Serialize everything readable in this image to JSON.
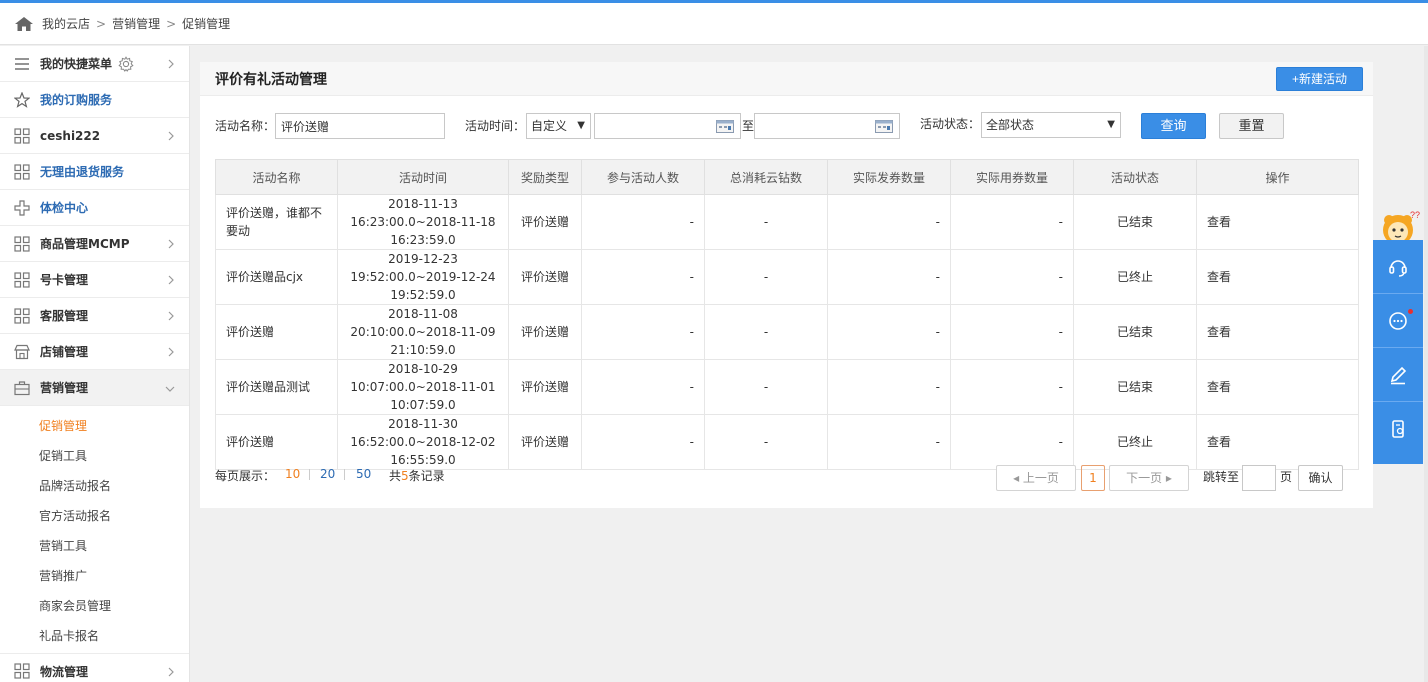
{
  "breadcrumb": [
    "我的云店",
    "营销管理",
    "促销管理"
  ],
  "sidebar": {
    "items": [
      {
        "label": "我的快捷菜单",
        "icon": "menu-lines-icon",
        "blue": false
      },
      {
        "label": "我的订购服务",
        "icon": "star-icon",
        "blue": true
      },
      {
        "label": "ceshi222",
        "icon": "grid-icon",
        "blue": false
      },
      {
        "label": "无理由退货服务",
        "icon": "grid-icon",
        "blue": true
      },
      {
        "label": "体检中心",
        "icon": "plus-icon",
        "blue": true
      },
      {
        "label": "商品管理MCMP",
        "icon": "grid-icon",
        "blue": false
      },
      {
        "label": "号卡管理",
        "icon": "grid-icon",
        "blue": false
      },
      {
        "label": "客服管理",
        "icon": "grid-icon",
        "blue": false
      },
      {
        "label": "店铺管理",
        "icon": "store-icon",
        "blue": false
      },
      {
        "label": "营销管理",
        "icon": "briefcase-icon",
        "blue": false
      }
    ],
    "submenu": [
      "促销管理",
      "促销工具",
      "品牌活动报名",
      "官方活动报名",
      "营销工具",
      "营销推广",
      "商家会员管理",
      "礼品卡报名"
    ],
    "bottom_item": {
      "label": "物流管理",
      "icon": "grid-icon"
    }
  },
  "panel": {
    "title": "评价有礼活动管理",
    "new_button": "+新建活动"
  },
  "filters": {
    "name_label": "活动名称：",
    "name_value": "评价送赠",
    "time_label": "活动时间：",
    "time_mode": "自定义",
    "to_label": "至",
    "start_date": "",
    "end_date": "",
    "status_label": "活动状态：",
    "status_value": "全部状态",
    "query_button": "查询",
    "reset_button": "重置"
  },
  "table": {
    "columns": [
      "活动名称",
      "活动时间",
      "奖励类型",
      "参与活动人数",
      "总消耗云钻数",
      "实际发券数量",
      "实际用券数量",
      "活动状态",
      "操作"
    ],
    "rows": [
      {
        "name": "评价送赠，谁都不要动",
        "time": "2018-11-13 16:23:00.0~2018-11-18 16:23:59.0",
        "reward": "评价送赠",
        "participants": "-",
        "consumed": "-",
        "issued": "-",
        "used": "-",
        "status": "已结束",
        "action": "查看"
      },
      {
        "name": "评价送赠品cjx",
        "time": "2019-12-23 19:52:00.0~2019-12-24 19:52:59.0",
        "reward": "评价送赠",
        "participants": "-",
        "consumed": "-",
        "issued": "-",
        "used": "-",
        "status": "已终止",
        "action": "查看"
      },
      {
        "name": "评价送赠",
        "time": "2018-11-08 20:10:00.0~2018-11-09 21:10:59.0",
        "reward": "评价送赠",
        "participants": "-",
        "consumed": "-",
        "issued": "-",
        "used": "-",
        "status": "已结束",
        "action": "查看"
      },
      {
        "name": "评价送赠品测试",
        "time": "2018-10-29 10:07:00.0~2018-11-01 10:07:59.0",
        "reward": "评价送赠",
        "participants": "-",
        "consumed": "-",
        "issued": "-",
        "used": "-",
        "status": "已结束",
        "action": "查看"
      },
      {
        "name": "评价送赠",
        "time": "2018-11-30 16:52:00.0~2018-12-02 16:55:59.0",
        "reward": "评价送赠",
        "participants": "-",
        "consumed": "-",
        "issued": "-",
        "used": "-",
        "status": "已终止",
        "action": "查看"
      }
    ]
  },
  "pager": {
    "per_page_label": "每页展示：",
    "sizes": [
      "10",
      "20",
      "50"
    ],
    "total_prefix": "共",
    "total_count": "5",
    "total_suffix": "条记录",
    "prev": "上一页",
    "current": "1",
    "next": "下一页",
    "jump_label": "跳转至",
    "page_unit": "页",
    "confirm": "确认"
  },
  "colors": {
    "accent": "#3a8ee6",
    "link": "#2d6bb3",
    "highlight": "#f08020"
  }
}
